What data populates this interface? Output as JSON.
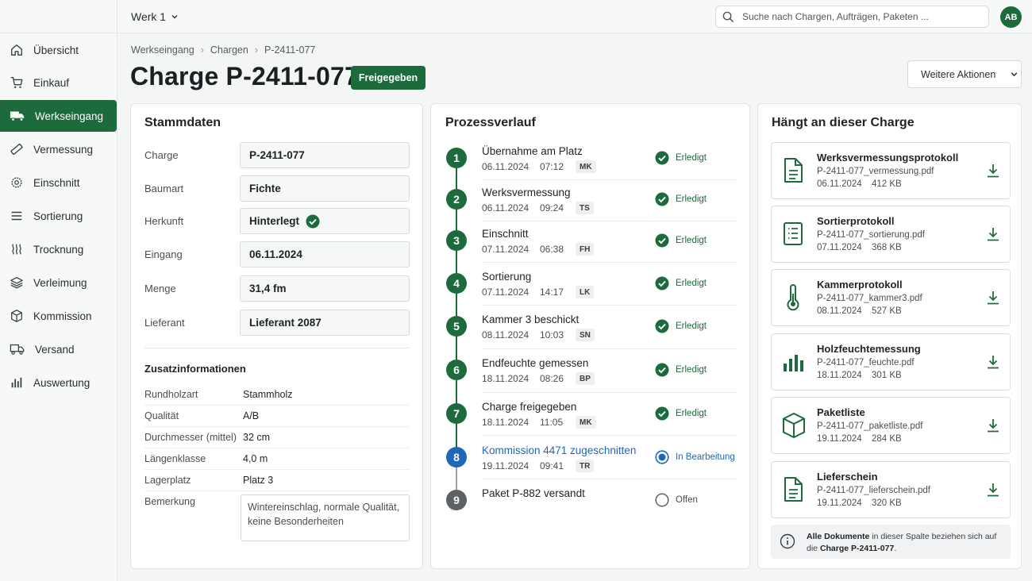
{
  "topbar": {
    "plant": "Werk 1",
    "search_placeholder": "Suche nach Chargen, Aufträgen, Paketen ...",
    "avatar": "AB"
  },
  "sidebar": {
    "items": [
      {
        "label": "Übersicht",
        "icon": "home-icon"
      },
      {
        "label": "Einkauf",
        "icon": "cart-icon"
      },
      {
        "label": "Werkseingang",
        "icon": "truck-icon",
        "active": true
      },
      {
        "label": "Vermessung",
        "icon": "ruler-icon"
      },
      {
        "label": "Einschnitt",
        "icon": "saw-blade-icon"
      },
      {
        "label": "Sortierung",
        "icon": "sort-icon"
      },
      {
        "label": "Trocknung",
        "icon": "heat-icon"
      },
      {
        "label": "Verleimung",
        "icon": "layers-icon"
      },
      {
        "label": "Kommission",
        "icon": "box-icon"
      },
      {
        "label": "Versand",
        "icon": "shipping-icon"
      },
      {
        "label": "Auswertung",
        "icon": "chart-icon"
      }
    ]
  },
  "header": {
    "breadcrumb": [
      "Werkseingang",
      "Chargen",
      "P-2411-077"
    ],
    "title": "Charge P-2411-077",
    "status": "Freigegeben",
    "more_actions": "Weitere Aktionen"
  },
  "stammdaten": {
    "title": "Stammdaten",
    "fields": [
      {
        "label": "Charge",
        "value": "P-2411-077"
      },
      {
        "label": "Baumart",
        "value": "Fichte"
      },
      {
        "label": "Herkunft",
        "value": "Hinterlegt",
        "check": true
      },
      {
        "label": "Eingang",
        "value": "06.11.2024"
      },
      {
        "label": "Menge",
        "value": "31,4 fm"
      },
      {
        "label": "Lieferant",
        "value": "Lieferant 2087"
      }
    ],
    "extra_title": "Zusatzinformationen",
    "extra": [
      {
        "label": "Rundholzart",
        "value": "Stammholz"
      },
      {
        "label": "Qualität",
        "value": "A/B"
      },
      {
        "label": "Durchmesser (mittel)",
        "value": "32 cm"
      },
      {
        "label": "Längenklasse",
        "value": "4,0 m"
      },
      {
        "label": "Lagerplatz",
        "value": "Platz 3"
      }
    ],
    "remark_label": "Bemerkung",
    "remark": "Wintereinschlag, normale Qualität, keine Besonderheiten"
  },
  "process": {
    "title": "Prozessverlauf",
    "steps": [
      {
        "n": "1",
        "name": "Übernahme am Platz",
        "date": "06.11.2024",
        "time": "07:12",
        "who": "MK",
        "status": "Erledigt",
        "state": "done"
      },
      {
        "n": "2",
        "name": "Werksvermessung",
        "date": "06.11.2024",
        "time": "09:24",
        "who": "TS",
        "status": "Erledigt",
        "state": "done"
      },
      {
        "n": "3",
        "name": "Einschnitt",
        "date": "07.11.2024",
        "time": "06:38",
        "who": "FH",
        "status": "Erledigt",
        "state": "done"
      },
      {
        "n": "4",
        "name": "Sortierung",
        "date": "07.11.2024",
        "time": "14:17",
        "who": "LK",
        "status": "Erledigt",
        "state": "done"
      },
      {
        "n": "5",
        "name": "Kammer 3 beschickt",
        "date": "08.11.2024",
        "time": "10:03",
        "who": "SN",
        "status": "Erledigt",
        "state": "done"
      },
      {
        "n": "6",
        "name": "Endfeuchte gemessen",
        "date": "18.11.2024",
        "time": "08:26",
        "who": "BP",
        "status": "Erledigt",
        "state": "done"
      },
      {
        "n": "7",
        "name": "Charge freigegeben",
        "date": "18.11.2024",
        "time": "11:05",
        "who": "MK",
        "status": "Erledigt",
        "state": "done"
      },
      {
        "n": "8",
        "name": "Kommission 4471 zugeschnitten",
        "date": "19.11.2024",
        "time": "09:41",
        "who": "TR",
        "status": "In Bearbeitung",
        "state": "active"
      },
      {
        "n": "9",
        "name": "Paket P-882 versandt",
        "status": "Offen",
        "state": "open"
      }
    ]
  },
  "documents": {
    "title": "Hängt an dieser Charge",
    "items": [
      {
        "name": "Werksvermessungsprotokoll",
        "file": "P-2411-077_vermessung.pdf",
        "date": "06.11.2024",
        "size": "412 KB",
        "icon": "document-icon"
      },
      {
        "name": "Sortierprotokoll",
        "file": "P-2411-077_sortierung.pdf",
        "date": "07.11.2024",
        "size": "368 KB",
        "icon": "list-document-icon"
      },
      {
        "name": "Kammerprotokoll",
        "file": "P-2411-077_kammer3.pdf",
        "date": "08.11.2024",
        "size": "527 KB",
        "icon": "thermometer-icon"
      },
      {
        "name": "Holzfeuchtemessung",
        "file": "P-2411-077_feuchte.pdf",
        "date": "18.11.2024",
        "size": "301 KB",
        "icon": "bar-chart-icon"
      },
      {
        "name": "Paketliste",
        "file": "P-2411-077_paketliste.pdf",
        "date": "19.11.2024",
        "size": "284 KB",
        "icon": "package-icon"
      },
      {
        "name": "Lieferschein",
        "file": "P-2411-077_lieferschein.pdf",
        "date": "19.11.2024",
        "size": "320 KB",
        "icon": "document-icon"
      }
    ],
    "note_bold1": "Alle Dokumente",
    "note_mid": " in dieser Spalte beziehen sich auf die ",
    "note_bold2": "Charge P-2411-077",
    "note_end": "."
  },
  "colors": {
    "accent": "#1d6b3d",
    "active": "#1f67b8",
    "open": "#5c6166"
  }
}
